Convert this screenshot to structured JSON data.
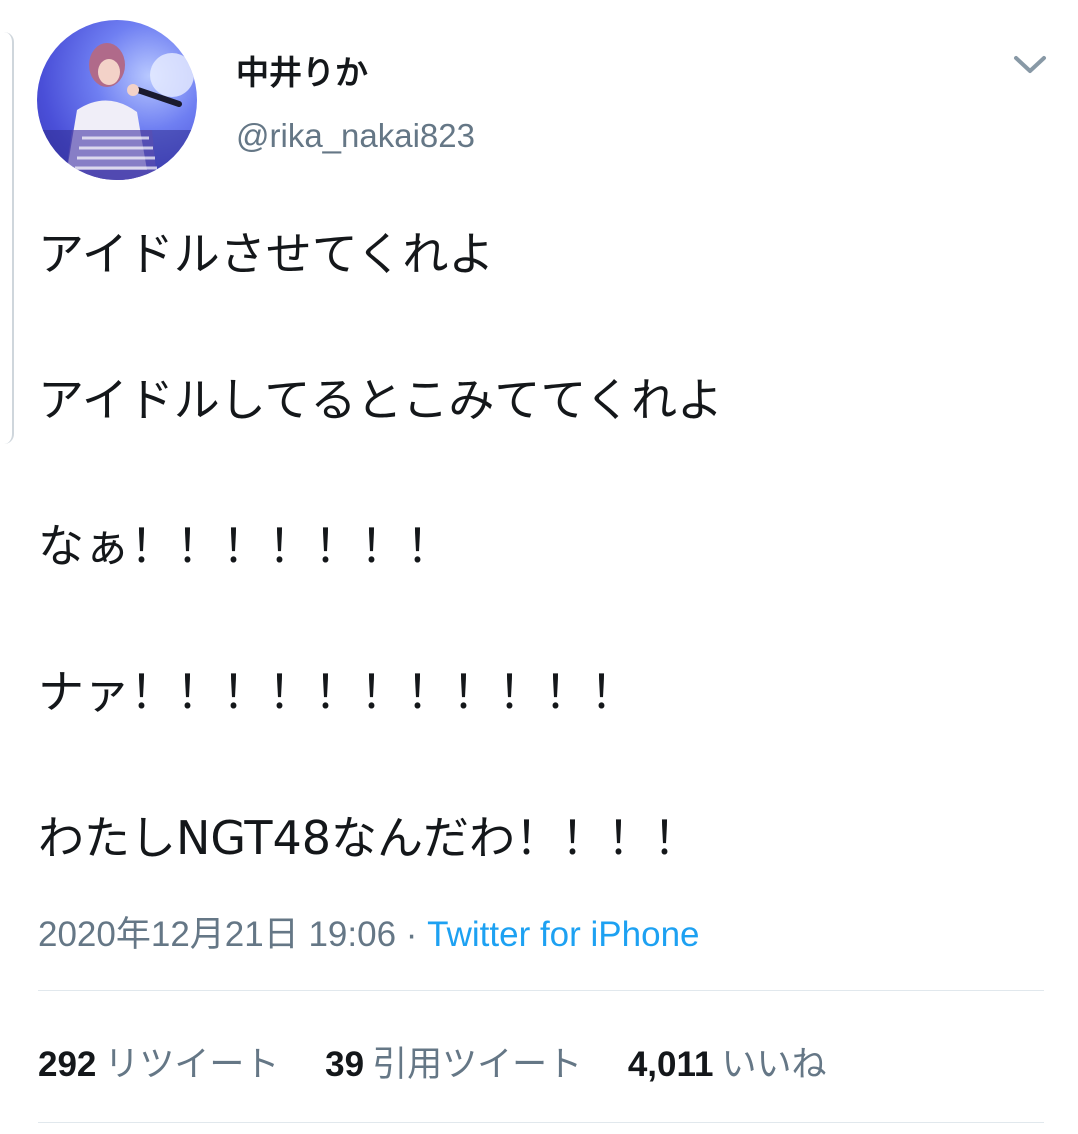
{
  "author": {
    "display_name": "中井りか",
    "handle": "@rika_nakai823"
  },
  "tweet": {
    "lines": [
      "アイドルさせてくれよ",
      "アイドルしてるとこみててくれよ",
      "なぁ！！！！！！！",
      "ナァ！！！！！！！！！！！",
      "わたしNGT48なんだわ！！！！"
    ]
  },
  "meta": {
    "timestamp": "2020年12月21日 19:06",
    "separator": " · ",
    "source": "Twitter for iPhone"
  },
  "stats": {
    "retweets_count": "292",
    "retweets_label": "リツイート",
    "quotes_count": "39",
    "quotes_label": "引用ツイート",
    "likes_count": "4,011",
    "likes_label": "いいね"
  },
  "colors": {
    "link": "#1da1f2",
    "secondary_text": "#657786",
    "primary_text": "#14171a"
  },
  "icons": {
    "more": "chevron-down-icon"
  }
}
